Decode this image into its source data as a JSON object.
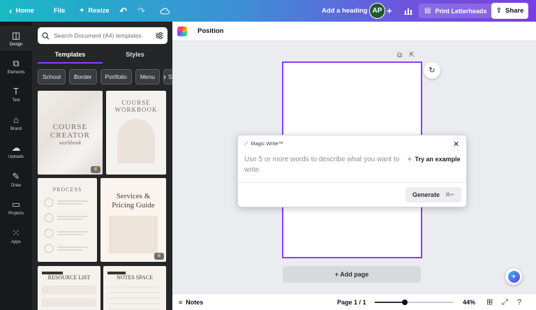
{
  "topbar": {
    "home_label": "Home",
    "file_label": "File",
    "resize_label": "Resize",
    "undo_icon": "undo-icon",
    "redo_icon": "redo-icon",
    "cloud_icon": "cloud-icon",
    "doc_title": "Add a heading",
    "avatar_initials": "AP",
    "print_label": "Print Letterheads",
    "share_label": "Share"
  },
  "rail": {
    "items": [
      {
        "label": "Design",
        "icon": "design-icon"
      },
      {
        "label": "Elements",
        "icon": "elements-icon"
      },
      {
        "label": "Text",
        "icon": "text-icon"
      },
      {
        "label": "Brand",
        "icon": "brand-icon"
      },
      {
        "label": "Uploads",
        "icon": "uploads-icon"
      },
      {
        "label": "Draw",
        "icon": "draw-icon"
      },
      {
        "label": "Projects",
        "icon": "projects-icon"
      },
      {
        "label": "Apps",
        "icon": "apps-icon"
      }
    ]
  },
  "panel": {
    "search_placeholder": "Search Document (A4) templates",
    "tabs": [
      "Templates",
      "Styles"
    ],
    "chips": [
      "School",
      "Border",
      "Portfolio",
      "Menu",
      "Sch"
    ],
    "templates": [
      {
        "lines": [
          "COURSE",
          "CREATOR",
          "workbook"
        ]
      },
      {
        "lines": [
          "COURSE",
          "WORKBOOK"
        ]
      },
      {
        "lines": [
          "PROCESS"
        ]
      },
      {
        "lines": [
          "Services &",
          "Pricing Guide"
        ]
      },
      {
        "lines": [
          "RESOURCE LIST"
        ]
      },
      {
        "lines": [
          "NOTES SPACE"
        ]
      }
    ]
  },
  "editor": {
    "context_label": "Position",
    "add_page_label": "+ Add page"
  },
  "magic_write": {
    "title": "Magic Write™",
    "placeholder": "Use 5 or more words to describe what you want to write",
    "try_label": "Try an example",
    "generate_label": "Generate",
    "shortcut": "⌘↩"
  },
  "bottom": {
    "notes_label": "Notes",
    "page_label": "Page 1 / 1",
    "zoom_value": "44%",
    "zoom_fraction": 0.38
  }
}
